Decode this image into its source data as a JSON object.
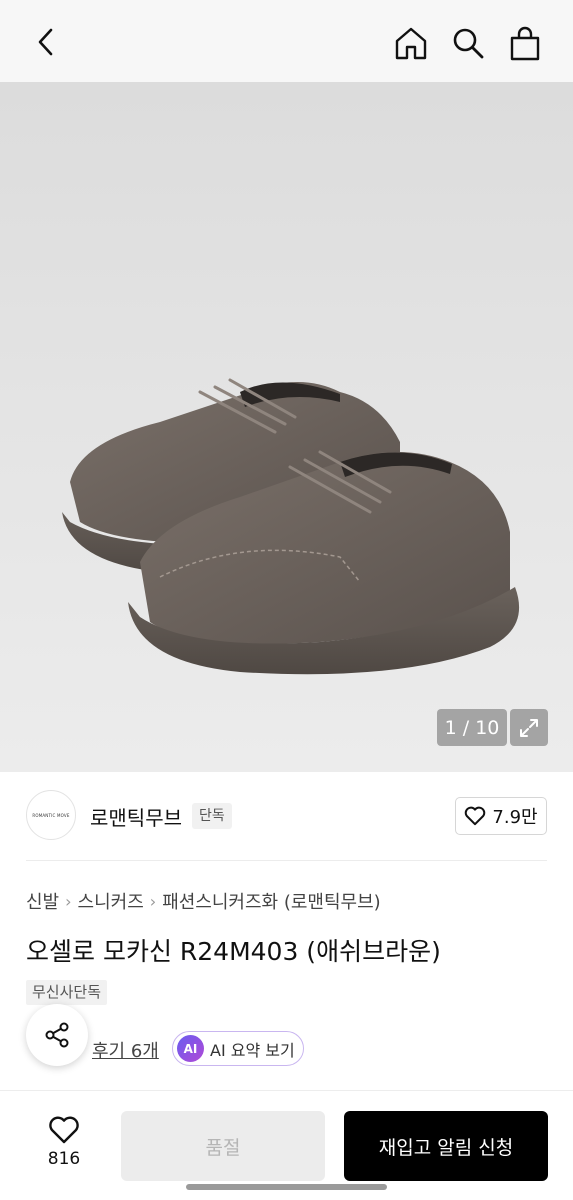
{
  "header": {
    "icons": [
      "chevron-left-icon",
      "home-icon",
      "search-icon",
      "shopping-bag-icon"
    ]
  },
  "gallery": {
    "pager": "1 / 10",
    "shoe_color": "#6b625c"
  },
  "brand": {
    "logo_text": "ROMANTIC MOVE",
    "name": "로맨틱무브",
    "badge": "단독",
    "likes": "7.9만"
  },
  "product": {
    "breadcrumb": [
      "신발",
      "스니커즈",
      "패션스니커즈화 (로맨틱무브)"
    ],
    "title": "오셀로 모카신 R24M403 (애쉬브라운)",
    "exclusive_tag": "무신사단독",
    "review_link": "후기 6개",
    "ai_badge": "AI",
    "ai_summary": "AI 요약 보기"
  },
  "bottom_bar": {
    "wish_count": "816",
    "soldout_label": "품절",
    "restock_label": "재입고 알림 신청"
  },
  "colors": {
    "primary_button": "#000000",
    "disabled_button": "#ececec",
    "ai_gradient_start": "#6a5cf0",
    "ai_gradient_end": "#b04ad6"
  }
}
